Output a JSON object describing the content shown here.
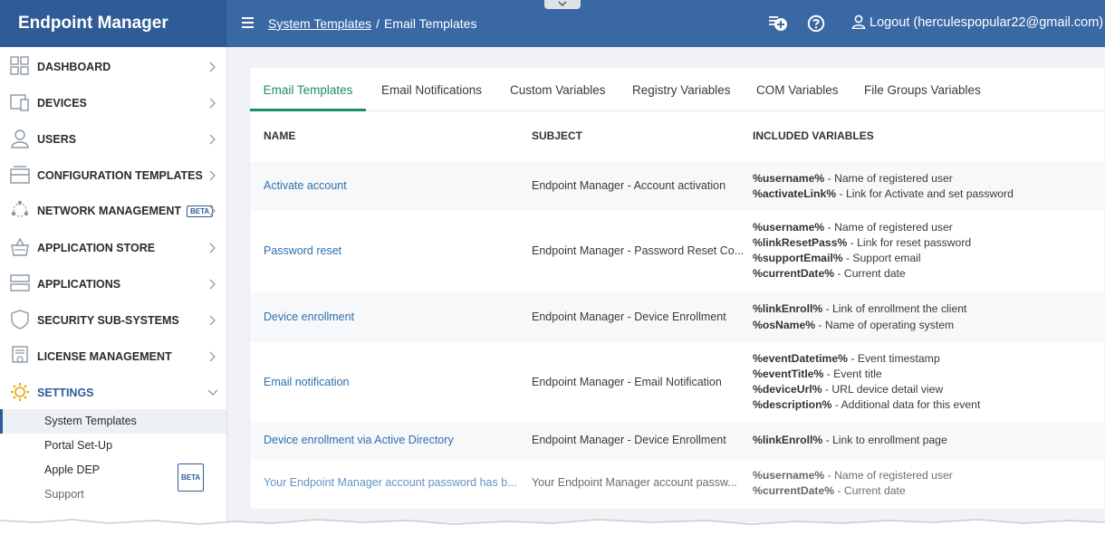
{
  "app": {
    "title": "Endpoint Manager"
  },
  "header": {
    "breadcrumb": {
      "parent": "System Templates",
      "separator": "/",
      "current": "Email Templates"
    },
    "logout_label": "Logout (herculespopular22@gmail.com)",
    "icons": [
      "menu-icon",
      "add-notification-icon",
      "help-icon",
      "user-icon"
    ]
  },
  "sidebar": {
    "items": [
      {
        "label": "DASHBOARD",
        "icon": "dashboard-icon"
      },
      {
        "label": "DEVICES",
        "icon": "devices-icon"
      },
      {
        "label": "USERS",
        "icon": "user-icon"
      },
      {
        "label": "CONFIGURATION TEMPLATES",
        "icon": "templates-icon"
      },
      {
        "label": "NETWORK MANAGEMENT",
        "icon": "network-icon",
        "badge": "BETA"
      },
      {
        "label": "APPLICATION STORE",
        "icon": "store-icon"
      },
      {
        "label": "APPLICATIONS",
        "icon": "applications-icon"
      },
      {
        "label": "SECURITY SUB-SYSTEMS",
        "icon": "shield-icon"
      },
      {
        "label": "LICENSE MANAGEMENT",
        "icon": "license-icon"
      },
      {
        "label": "SETTINGS",
        "icon": "gear-icon"
      }
    ],
    "subitems": [
      {
        "label": "System Templates"
      },
      {
        "label": "Portal Set-Up"
      },
      {
        "label": "Apple DEP",
        "badge": "BETA"
      },
      {
        "label": "Support"
      }
    ]
  },
  "tabs": [
    "Email Templates",
    "Email Notifications",
    "Custom Variables",
    "Registry Variables",
    "COM Variables",
    "File Groups Variables"
  ],
  "table": {
    "headers": [
      "NAME",
      "SUBJECT",
      "INCLUDED VARIABLES"
    ],
    "rows": [
      {
        "name": "Activate account",
        "subject": "Endpoint Manager - Account activation",
        "vars": [
          {
            "key": "%username%",
            "desc": " - Name of registered user"
          },
          {
            "key": "%activateLink%",
            "desc": " - Link for Activate and set password"
          }
        ]
      },
      {
        "name": "Password reset",
        "subject": "Endpoint Manager - Password Reset Co...",
        "vars": [
          {
            "key": "%username%",
            "desc": " - Name of registered user"
          },
          {
            "key": "%linkResetPass%",
            "desc": " - Link for reset password"
          },
          {
            "key": "%supportEmail%",
            "desc": " - Support email"
          },
          {
            "key": "%currentDate%",
            "desc": " - Current date"
          }
        ]
      },
      {
        "name": "Device enrollment",
        "subject": "Endpoint Manager - Device Enrollment",
        "vars": [
          {
            "key": "%linkEnroll%",
            "desc": " - Link of enrollment the client"
          },
          {
            "key": "%osName%",
            "desc": " - Name of operating system"
          }
        ]
      },
      {
        "name": "Email notification",
        "subject": "Endpoint Manager - Email Notification",
        "vars": [
          {
            "key": "%eventDatetime%",
            "desc": " - Event timestamp"
          },
          {
            "key": "%eventTitle%",
            "desc": " - Event title"
          },
          {
            "key": "%deviceUrl%",
            "desc": " - URL device detail view"
          },
          {
            "key": "%description%",
            "desc": " - Additional data for this event"
          }
        ]
      },
      {
        "name": "Device enrollment via Active Directory",
        "subject": "Endpoint Manager - Device Enrollment",
        "vars": [
          {
            "key": "%linkEnroll%",
            "desc": " - Link to enrollment page"
          }
        ]
      },
      {
        "name": "Your Endpoint Manager account password has b...",
        "subject": "Your Endpoint Manager account passw...",
        "vars": [
          {
            "key": "%username%",
            "desc": " - Name of registered user"
          },
          {
            "key": "%currentDate%",
            "desc": " - Current date"
          }
        ]
      }
    ]
  },
  "colors": {
    "header": "#3a68a5",
    "brand": "#2f5c97",
    "active_tab": "#1a8c6f",
    "link": "#2f6fae"
  }
}
